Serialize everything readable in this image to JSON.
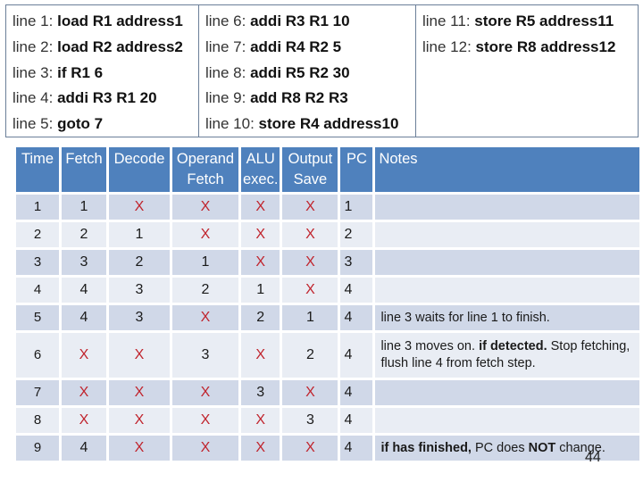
{
  "program": {
    "columns": [
      [
        {
          "prefix": "line 1: ",
          "instr": "load R1 address1"
        },
        {
          "prefix": "line 2: ",
          "instr": "load R2 address2"
        },
        {
          "prefix": "line 3: ",
          "instr": "if R1 6"
        },
        {
          "prefix": "line 4: ",
          "instr": "addi R3 R1 20"
        },
        {
          "prefix": "line 5: ",
          "instr": "goto 7"
        }
      ],
      [
        {
          "prefix": "line 6: ",
          "instr": "addi R3 R1 10"
        },
        {
          "prefix": "line 7: ",
          "instr": "addi R4 R2 5"
        },
        {
          "prefix": "line 8: ",
          "instr": "addi R5 R2 30"
        },
        {
          "prefix": "line 9: ",
          "instr": "add R8 R2 R3"
        },
        {
          "prefix": "line 10: ",
          "instr": "store R4 address10"
        }
      ],
      [
        {
          "prefix": "line 11: ",
          "instr": "store R5 address11"
        },
        {
          "prefix": "line 12: ",
          "instr": "store R8 address12"
        }
      ]
    ]
  },
  "table": {
    "headers": [
      "Time",
      "Fetch",
      "Decode",
      "Operand Fetch",
      "ALU exec.",
      "Output Save",
      "PC",
      "Notes"
    ],
    "rows": [
      {
        "time": "1",
        "fetch": "1",
        "decode": "X",
        "operand": "X",
        "alu": "X",
        "output": "X",
        "pc": "1",
        "notes": ""
      },
      {
        "time": "2",
        "fetch": "2",
        "decode": "1",
        "operand": "X",
        "alu": "X",
        "output": "X",
        "pc": "2",
        "notes": ""
      },
      {
        "time": "3",
        "fetch": "3",
        "decode": "2",
        "operand": "1",
        "alu": "X",
        "output": "X",
        "pc": "3",
        "notes": ""
      },
      {
        "time": "4",
        "fetch": "4",
        "decode": "3",
        "operand": "2",
        "alu": "1",
        "output": "X",
        "pc": "4",
        "notes": ""
      },
      {
        "time": "5",
        "fetch": "4",
        "decode": "3",
        "operand": "X",
        "alu": "2",
        "output": "1",
        "pc": "4",
        "notes": "line 3 waits for line 1 to finish."
      },
      {
        "time": "6",
        "fetch": "X",
        "decode": "X",
        "operand": "3",
        "alu": "X",
        "output": "2",
        "pc": "4",
        "notes": "line 3 moves on. if detected. Stop fetching, flush line 4 from fetch step."
      },
      {
        "time": "7",
        "fetch": "X",
        "decode": "X",
        "operand": "X",
        "alu": "3",
        "output": "X",
        "pc": "4",
        "notes": ""
      },
      {
        "time": "8",
        "fetch": "X",
        "decode": "X",
        "operand": "X",
        "alu": "X",
        "output": "3",
        "pc": "4",
        "notes": ""
      },
      {
        "time": "9",
        "fetch": "4",
        "decode": "X",
        "operand": "X",
        "alu": "X",
        "output": "X",
        "pc": "4",
        "notes": "if has finished, PC does NOT  change."
      }
    ],
    "notes_rich": {
      "row6": {
        "p1": "line 3 moves on. ",
        "b1": "if detected.",
        "p2": " Stop fetching, flush line 4 from fetch step."
      },
      "row9": {
        "b1": "if has finished,",
        "p1": " PC does ",
        "b2": "NOT",
        "p2": "  change."
      }
    }
  },
  "colors": {
    "header_bg": "#4f81bd",
    "row_odd": "#d0d8e8",
    "row_even": "#e9edf4",
    "x_mark": "#c0242d"
  },
  "page_number": "44"
}
